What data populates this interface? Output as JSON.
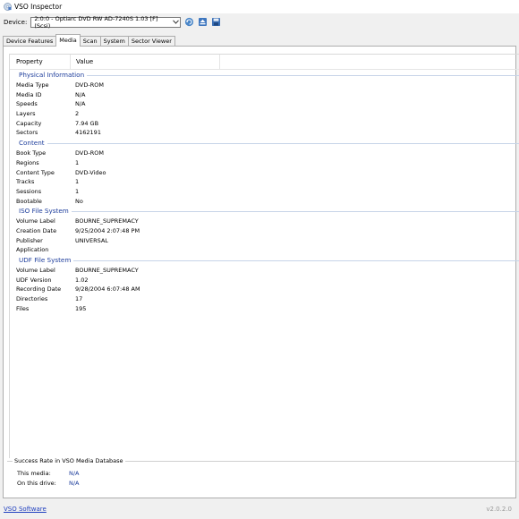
{
  "window": {
    "title": "VSO Inspector"
  },
  "device": {
    "label": "Device:",
    "selected": "2:0:0 - Optiarc DVD RW AD-7240S 1.03 [F] (Scsi)"
  },
  "toolbar": {
    "icons": [
      "refresh-icon",
      "eject-icon",
      "save-icon"
    ]
  },
  "tabs": [
    {
      "label": "Device Features",
      "active": false
    },
    {
      "label": "Media",
      "active": true
    },
    {
      "label": "Scan",
      "active": false
    },
    {
      "label": "System",
      "active": false
    },
    {
      "label": "Sector Viewer",
      "active": false
    }
  ],
  "table": {
    "headers": {
      "property": "Property",
      "value": "Value"
    },
    "groups": [
      {
        "title": "Physical Information",
        "rows": [
          {
            "p": "Media Type",
            "v": "DVD-ROM"
          },
          {
            "p": "Media ID",
            "v": "N/A"
          },
          {
            "p": "Speeds",
            "v": "N/A"
          },
          {
            "p": "Layers",
            "v": "2"
          },
          {
            "p": "Capacity",
            "v": "7.94 GB"
          },
          {
            "p": "Sectors",
            "v": "4162191"
          }
        ]
      },
      {
        "title": "Content",
        "rows": [
          {
            "p": "Book Type",
            "v": "DVD-ROM"
          },
          {
            "p": "Regions",
            "v": "1"
          },
          {
            "p": "Content Type",
            "v": "DVD-Video"
          },
          {
            "p": "Tracks",
            "v": "1"
          },
          {
            "p": "Sessions",
            "v": "1"
          },
          {
            "p": "Bootable",
            "v": "No"
          }
        ]
      },
      {
        "title": "ISO File System",
        "rows": [
          {
            "p": "Volume Label",
            "v": "BOURNE_SUPREMACY"
          },
          {
            "p": "Creation Date",
            "v": "9/25/2004 2:07:48 PM"
          },
          {
            "p": "Publisher",
            "v": "UNIVERSAL"
          },
          {
            "p": "Application",
            "v": ""
          }
        ]
      },
      {
        "title": "UDF File System",
        "rows": [
          {
            "p": "Volume Label",
            "v": "BOURNE_SUPREMACY"
          },
          {
            "p": "UDF Version",
            "v": "1.02"
          },
          {
            "p": "Recording Date",
            "v": "9/28/2004 6:07:48 AM"
          },
          {
            "p": "Directories",
            "v": "17"
          },
          {
            "p": "Files",
            "v": "195"
          }
        ]
      }
    ]
  },
  "success_rate": {
    "title": "Success Rate in VSO Media Database",
    "this_media_label": "This media:",
    "this_media_value": "N/A",
    "this_drive_label": "On this drive:",
    "this_drive_value": "N/A"
  },
  "footer": {
    "link": "VSO Software",
    "version": "v2.0.2.0"
  },
  "colors": {
    "accent": "#1e3e9c",
    "link": "#1f3fbf"
  }
}
